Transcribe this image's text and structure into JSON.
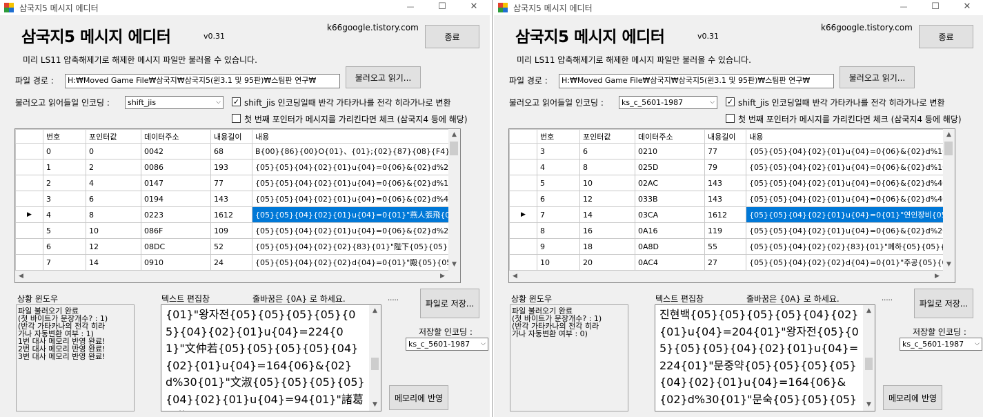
{
  "windows": [
    {
      "window_title": "삼국지5 메시지 에디터",
      "app_title": "삼국지5 메시지 에디터",
      "version": "v0.31",
      "site": "k66google.tistory.com",
      "close_btn": "종료",
      "notice": "미리 LS11 압축해제기로 해제한 메시지 파일만 불러올 수 있습니다.",
      "path_label": "파일 경로 :",
      "path_value": "H:₩Moved Game File₩삼국지₩삼국지5(윈3.1 및 95판)₩스팀판 연구₩",
      "load_btn": "불러오고 읽기...",
      "enc_label": "불러오고 읽어들일 인코딩 :",
      "enc_value": "shift_jis",
      "chk1_label": "shift_jis 인코딩일때 반각 가타카나를 전각 히라가나로 변환",
      "chk1_checked": "✓",
      "chk2_label": "첫 번째 포인터가 메시지를 가리킨다면 체크 (삼국지4 등에 해당)",
      "grid": {
        "headers": [
          "번호",
          "포인터값",
          "데이터주소",
          "내용길이",
          "내용"
        ],
        "rows": [
          {
            "no": "0",
            "ptr": "0",
            "addr": "0042",
            "len": "68",
            "content": "B{00}{86}{00}O{01}、{01};{02}{87}{08}{F4}{08}{..."
          },
          {
            "no": "1",
            "ptr": "2",
            "addr": "0086",
            "len": "193",
            "content": "{05}{05}{04}{02}{01}u{04}=0{06}&{02}d%20{01}\"..."
          },
          {
            "no": "2",
            "ptr": "4",
            "addr": "0147",
            "len": "77",
            "content": "{05}{05}{04}{02}{01}u{04}=0{06}&{02}d%10{01}\"..."
          },
          {
            "no": "3",
            "ptr": "6",
            "addr": "0194",
            "len": "143",
            "content": "{05}{05}{04}{02}{01}u{04}=0{06}&{02}d%40{01}\"..."
          },
          {
            "no": "4",
            "ptr": "8",
            "addr": "0223",
            "len": "1612",
            "content": "{05}{05}{04}{02}{01}u{04}=0{01}\"燕人張飛{05}{05..."
          },
          {
            "no": "5",
            "ptr": "10",
            "addr": "086F",
            "len": "109",
            "content": "{05}{05}{04}{02}{01}u{04}=0{06}&{02}d%20{01}\"..."
          },
          {
            "no": "6",
            "ptr": "12",
            "addr": "08DC",
            "len": "52",
            "content": "{05}{05}{04}{02}{02}{83}{01}\"陛下{05}{05}{0..."
          },
          {
            "no": "7",
            "ptr": "14",
            "addr": "0910",
            "len": "24",
            "content": "{05}{05}{04}{02}{02}d{04}=0{01}\"殿{05}{05}{05}{..."
          }
        ],
        "selected_index": 4
      },
      "status_title": "상황 윈도우",
      "status_lines": [
        "파일 불러오기 완료",
        "(첫 바이트가 문장개수? : 1)",
        "(반각 가타카나의 전각 히라",
        "가나 자동변환 여부 : 1)",
        "1번 대사 메모리 반영 완료!",
        "2번 대사 메모리 반영 완료!",
        "3번 대사 메모리 반영 완료!"
      ],
      "editor_title": "텍스트 편집창",
      "newline_hint": "줄바꿈은 {0A} 로 하세요.",
      "dots": ".....",
      "editor_text": "{01}\"왕자전{05}{05}{05}{05}{05}{04}{02}{01}u{04}=224{01}\"文仲若{05}{05}{05}{05}{04}{02}{01}u{04}=164{06}&{02}d%30{01}\"文淑{05}{05}{05}{05}{04}{02}{01}u{04}=94{01}\"諸葛公休{05}{05}{05}",
      "save_btn": "파일로 저장...",
      "save_enc_label": "저장할 인코딩 :",
      "save_enc_value": "ks_c_5601-1987",
      "apply_btn": "메모리에 반영"
    },
    {
      "window_title": "삼국지5 메시지 에디터",
      "app_title": "삼국지5 메시지 에디터",
      "version": "v0.31",
      "site": "k66google.tistory.com",
      "close_btn": "종료",
      "notice": "미리 LS11 압축해제기로 해제한 메시지 파일만 불러올 수 있습니다.",
      "path_label": "파일 경로 :",
      "path_value": "H:₩Moved Game File₩삼국지₩삼국지5(윈3.1 및 95판)₩스팀판 연구₩",
      "load_btn": "불러오고 읽기...",
      "enc_label": "불러오고 읽어들일 인코딩 :",
      "enc_value": "ks_c_5601-1987",
      "chk1_label": "shift_jis 인코딩일때 반각 가타카나를 전각 히라가나로 변환",
      "chk1_checked": "✓",
      "chk2_label": "첫 번째 포인터가 메시지를 가리킨다면 체크 (삼국지4 등에 해당)",
      "grid": {
        "headers": [
          "번호",
          "포인터값",
          "데이터주소",
          "내용길이",
          "내용"
        ],
        "rows": [
          {
            "no": "3",
            "ptr": "6",
            "addr": "0210",
            "len": "77",
            "content": "{05}{05}{04}{02}{01}u{04}=0{06}&{02}d%10{01}\"..."
          },
          {
            "no": "4",
            "ptr": "8",
            "addr": "025D",
            "len": "79",
            "content": "{05}{05}{04}{02}{01}u{04}=0{06}&{02}d%10{01}\"..."
          },
          {
            "no": "5",
            "ptr": "10",
            "addr": "02AC",
            "len": "143",
            "content": "{05}{05}{04}{02}{01}u{04}=0{06}&{02}d%40{01}\"..."
          },
          {
            "no": "6",
            "ptr": "12",
            "addr": "033B",
            "len": "143",
            "content": "{05}{05}{04}{02}{01}u{04}=0{06}&{02}d%40{01}\"..."
          },
          {
            "no": "7",
            "ptr": "14",
            "addr": "03CA",
            "len": "1612",
            "content": "{05}{05}{04}{02}{01}u{04}=0{01}\"연인장비{05}{05..."
          },
          {
            "no": "8",
            "ptr": "16",
            "addr": "0A16",
            "len": "119",
            "content": "{05}{05}{04}{02}{01}u{04}=0{06}&{02}d%20{01}\"..."
          },
          {
            "no": "9",
            "ptr": "18",
            "addr": "0A8D",
            "len": "55",
            "content": "{05}{05}{04}{02}{02}{83}{01}\"폐하{05}{05}{0..."
          },
          {
            "no": "10",
            "ptr": "20",
            "addr": "0AC4",
            "len": "27",
            "content": "{05}{05}{04}{02}{02}d{04}=0{01}\"주공{05}{05}{05..."
          }
        ],
        "selected_index": 4
      },
      "status_title": "상황 윈도우",
      "status_lines": [
        "파일 불러오기 완료",
        "(첫 바이트가 문장개수? : 1)",
        "(반각 가타카나의 전각 히라",
        "가나 자동변환 여부 : 0)"
      ],
      "editor_title": "텍스트 편집창",
      "newline_hint": "줄바꿈은 {0A} 로 하세요.",
      "dots": ".....",
      "editor_text": "진현백{05}{05}{05}{05}{04}{02}{01}u{04}=204{01}\"왕자전{05}{05}{05}{05}{04}{02}{01}u{04}=224{01}\"문중약{05}{05}{05}{05}{04}{02}{01}u{04}=164{06}&{02}d%30{01}\"문숙{05}{05}{05}{05}{05}",
      "save_btn": "파일로 저장...",
      "save_enc_label": "저장할 인코딩 :",
      "save_enc_value": "ks_c_5601-1987",
      "apply_btn": "메모리에 반영"
    }
  ],
  "icons": {
    "app": "four-color-squares-icon",
    "minimize": "minimize-icon",
    "maximize": "maximize-icon",
    "close": "close-icon",
    "row_pointer": "row-pointer-triangle-icon",
    "dropdown": "chevron-down-icon"
  },
  "colors": {
    "selection": "#0078d7",
    "window_bg": "#f0f0f0"
  }
}
